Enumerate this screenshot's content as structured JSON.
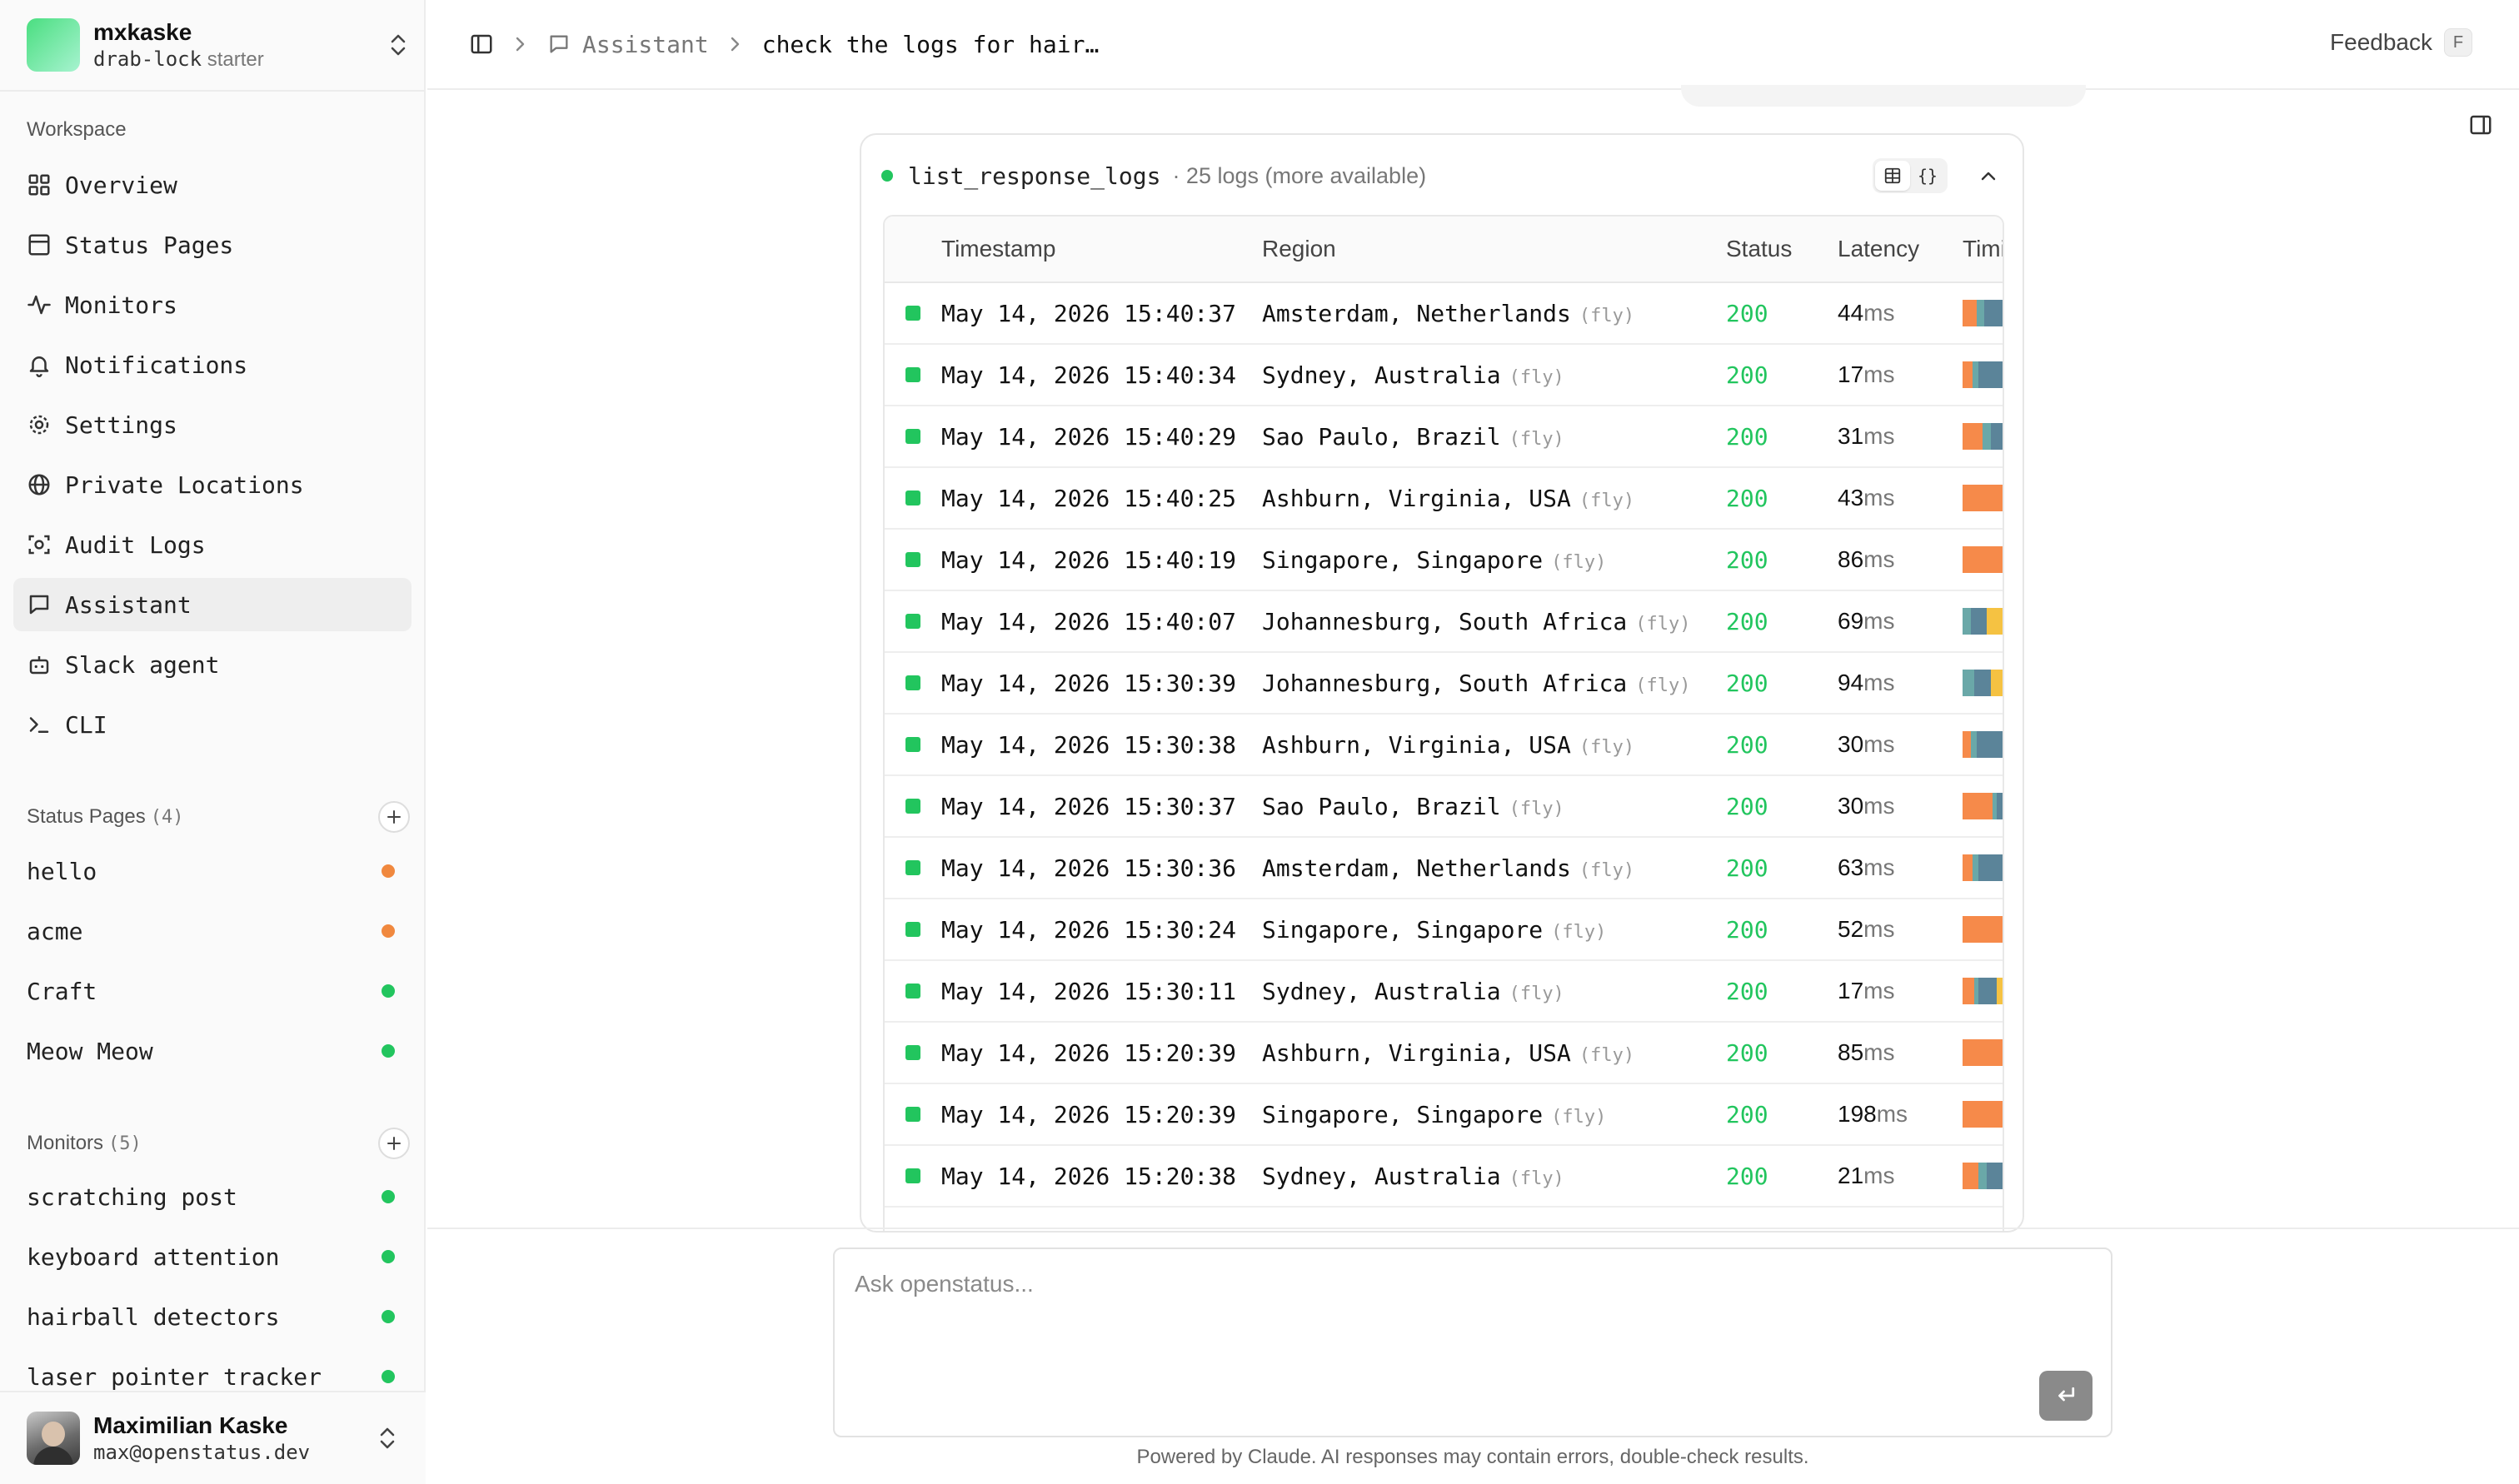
{
  "org": {
    "name": "mxkaske",
    "slug": "drab-lock",
    "plan": "starter"
  },
  "sidebar": {
    "workspace_label": "Workspace",
    "nav": [
      {
        "label": "Overview",
        "icon": "grid-icon"
      },
      {
        "label": "Status Pages",
        "icon": "panel-icon"
      },
      {
        "label": "Monitors",
        "icon": "activity-icon"
      },
      {
        "label": "Notifications",
        "icon": "bell-icon"
      },
      {
        "label": "Settings",
        "icon": "gear-icon"
      },
      {
        "label": "Private Locations",
        "icon": "globe-icon"
      },
      {
        "label": "Audit Logs",
        "icon": "scan-icon"
      },
      {
        "label": "Assistant",
        "icon": "message-icon",
        "active": true
      },
      {
        "label": "Slack agent",
        "icon": "bot-icon"
      },
      {
        "label": "CLI",
        "icon": "terminal-icon"
      }
    ],
    "status_pages": {
      "label": "Status Pages",
      "count": "(4)",
      "items": [
        {
          "name": "hello",
          "status_color": "#f0883e"
        },
        {
          "name": "acme",
          "status_color": "#f0883e"
        },
        {
          "name": "Craft",
          "status_color": "#22c55e"
        },
        {
          "name": "Meow Meow",
          "status_color": "#22c55e"
        }
      ]
    },
    "monitors": {
      "label": "Monitors",
      "count": "(5)",
      "items": [
        {
          "name": "scratching post",
          "status_color": "#22c55e"
        },
        {
          "name": "keyboard attention",
          "status_color": "#22c55e"
        },
        {
          "name": "hairball detectors",
          "status_color": "#22c55e"
        },
        {
          "name": "laser pointer tracker",
          "status_color": "#22c55e"
        }
      ]
    },
    "user": {
      "name": "Maximilian Kaske",
      "email": "max@openstatus.dev"
    }
  },
  "header": {
    "breadcrumb": {
      "section": "Assistant",
      "current": "check the logs for hair…"
    },
    "feedback_label": "Feedback",
    "feedback_shortcut": "F"
  },
  "tool_call": {
    "name": "list_response_logs",
    "meta": "· 25 logs (more available)",
    "toggle": {
      "table_icon": "table-icon",
      "json_label": "{}"
    },
    "columns": {
      "timestamp": "Timestamp",
      "region": "Region",
      "status": "Status",
      "latency": "Latency",
      "timing": "Timing"
    },
    "rows": [
      {
        "timestamp": "May 14, 2026 15:40:37",
        "region": "Amsterdam, Netherlands",
        "provider": "(fly)",
        "status": "200",
        "latency": "44",
        "unit": "ms",
        "timing": [
          {
            "c": "#f68a4a",
            "w": 0.35
          },
          {
            "c": "#6aa8a8",
            "w": 0.2
          },
          {
            "c": "#5b8499",
            "w": 0.45
          }
        ]
      },
      {
        "timestamp": "May 14, 2026 15:40:34",
        "region": "Sydney, Australia",
        "provider": "(fly)",
        "status": "200",
        "latency": "17",
        "unit": "ms",
        "timing": [
          {
            "c": "#f68a4a",
            "w": 0.25
          },
          {
            "c": "#6aa8a8",
            "w": 0.15
          },
          {
            "c": "#5b8499",
            "w": 0.6
          }
        ]
      },
      {
        "timestamp": "May 14, 2026 15:40:29",
        "region": "Sao Paulo, Brazil",
        "provider": "(fly)",
        "status": "200",
        "latency": "31",
        "unit": "ms",
        "timing": [
          {
            "c": "#f68a4a",
            "w": 0.5
          },
          {
            "c": "#6aa8a8",
            "w": 0.2
          },
          {
            "c": "#5b8499",
            "w": 0.3
          }
        ]
      },
      {
        "timestamp": "May 14, 2026 15:40:25",
        "region": "Ashburn, Virginia, USA",
        "provider": "(fly)",
        "status": "200",
        "latency": "43",
        "unit": "ms",
        "timing": [
          {
            "c": "#f68a4a",
            "w": 1.0
          }
        ]
      },
      {
        "timestamp": "May 14, 2026 15:40:19",
        "region": "Singapore, Singapore",
        "provider": "(fly)",
        "status": "200",
        "latency": "86",
        "unit": "ms",
        "timing": [
          {
            "c": "#f68a4a",
            "w": 1.0
          }
        ]
      },
      {
        "timestamp": "May 14, 2026 15:40:07",
        "region": "Johannesburg, South Africa",
        "provider": "(fly)",
        "status": "200",
        "latency": "69",
        "unit": "ms",
        "timing": [
          {
            "c": "#6aa8a8",
            "w": 0.2
          },
          {
            "c": "#5b8499",
            "w": 0.4
          },
          {
            "c": "#f5c242",
            "w": 0.4
          }
        ]
      },
      {
        "timestamp": "May 14, 2026 15:30:39",
        "region": "Johannesburg, South Africa",
        "provider": "(fly)",
        "status": "200",
        "latency": "94",
        "unit": "ms",
        "timing": [
          {
            "c": "#6aa8a8",
            "w": 0.3
          },
          {
            "c": "#5b8499",
            "w": 0.4
          },
          {
            "c": "#f5c242",
            "w": 0.3
          }
        ]
      },
      {
        "timestamp": "May 14, 2026 15:30:38",
        "region": "Ashburn, Virginia, USA",
        "provider": "(fly)",
        "status": "200",
        "latency": "30",
        "unit": "ms",
        "timing": [
          {
            "c": "#f68a4a",
            "w": 0.2
          },
          {
            "c": "#6aa8a8",
            "w": 0.15
          },
          {
            "c": "#5b8499",
            "w": 0.65
          }
        ]
      },
      {
        "timestamp": "May 14, 2026 15:30:37",
        "region": "Sao Paulo, Brazil",
        "provider": "(fly)",
        "status": "200",
        "latency": "30",
        "unit": "ms",
        "timing": [
          {
            "c": "#f68a4a",
            "w": 0.75
          },
          {
            "c": "#6aa8a8",
            "w": 0.1
          },
          {
            "c": "#5b8499",
            "w": 0.15
          }
        ]
      },
      {
        "timestamp": "May 14, 2026 15:30:36",
        "region": "Amsterdam, Netherlands",
        "provider": "(fly)",
        "status": "200",
        "latency": "63",
        "unit": "ms",
        "timing": [
          {
            "c": "#f68a4a",
            "w": 0.25
          },
          {
            "c": "#6aa8a8",
            "w": 0.15
          },
          {
            "c": "#5b8499",
            "w": 0.6
          }
        ]
      },
      {
        "timestamp": "May 14, 2026 15:30:24",
        "region": "Singapore, Singapore",
        "provider": "(fly)",
        "status": "200",
        "latency": "52",
        "unit": "ms",
        "timing": [
          {
            "c": "#f68a4a",
            "w": 1.0
          }
        ]
      },
      {
        "timestamp": "May 14, 2026 15:30:11",
        "region": "Sydney, Australia",
        "provider": "(fly)",
        "status": "200",
        "latency": "17",
        "unit": "ms",
        "timing": [
          {
            "c": "#f68a4a",
            "w": 0.3
          },
          {
            "c": "#6aa8a8",
            "w": 0.1
          },
          {
            "c": "#5b8499",
            "w": 0.45
          },
          {
            "c": "#f5c242",
            "w": 0.15
          }
        ]
      },
      {
        "timestamp": "May 14, 2026 15:20:39",
        "region": "Ashburn, Virginia, USA",
        "provider": "(fly)",
        "status": "200",
        "latency": "85",
        "unit": "ms",
        "timing": [
          {
            "c": "#f68a4a",
            "w": 1.0
          }
        ]
      },
      {
        "timestamp": "May 14, 2026 15:20:39",
        "region": "Singapore, Singapore",
        "provider": "(fly)",
        "status": "200",
        "latency": "198",
        "unit": "ms",
        "timing": [
          {
            "c": "#f68a4a",
            "w": 1.0
          }
        ]
      },
      {
        "timestamp": "May 14, 2026 15:20:38",
        "region": "Sydney, Australia",
        "provider": "(fly)",
        "status": "200",
        "latency": "21",
        "unit": "ms",
        "timing": [
          {
            "c": "#f68a4a",
            "w": 0.4
          },
          {
            "c": "#6aa8a8",
            "w": 0.2
          },
          {
            "c": "#5b8499",
            "w": 0.4
          }
        ]
      }
    ]
  },
  "composer": {
    "placeholder": "Ask openstatus...",
    "send_icon": "enter-icon",
    "disclaimer": "Powered by Claude. AI responses may contain errors, double-check results."
  },
  "colors": {
    "success": "#22c55e",
    "warning": "#f0883e"
  }
}
